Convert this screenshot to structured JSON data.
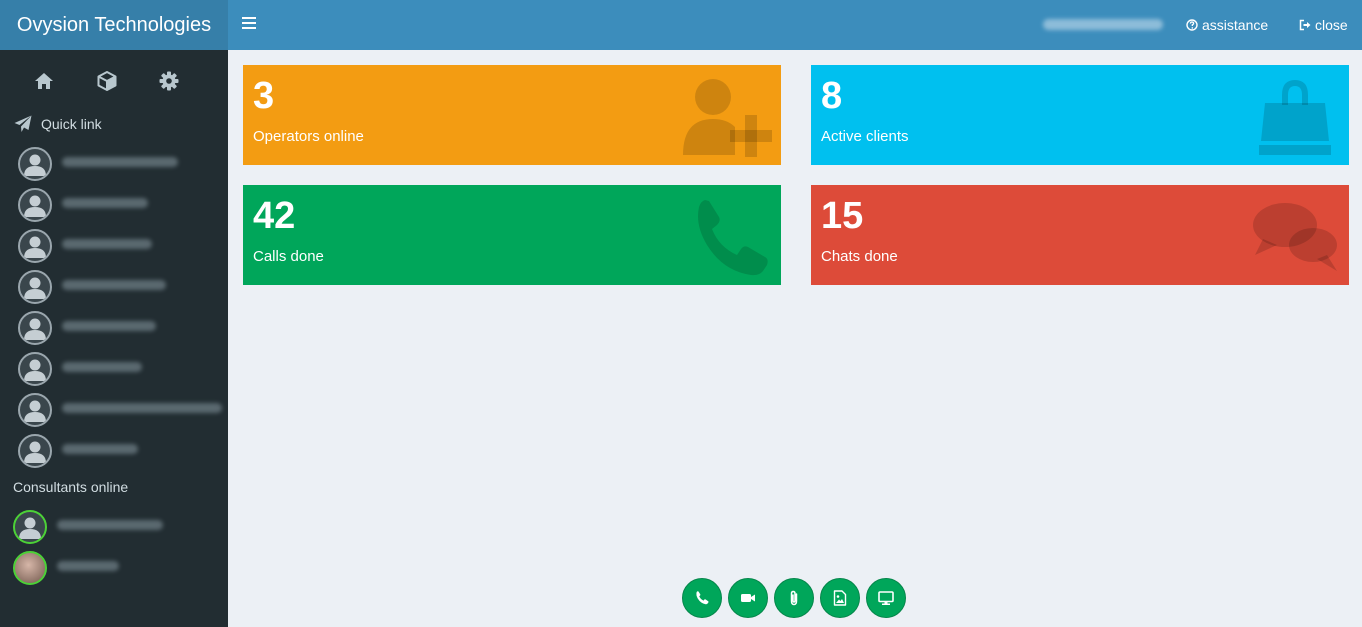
{
  "app": {
    "title": "Ovysion Technologies"
  },
  "topbar": {
    "assistance_label": "assistance",
    "close_label": "close"
  },
  "sidebar": {
    "nav_icons": [
      "home-icon",
      "cube-icon",
      "gear-icon"
    ],
    "quick_link_label": "Quick link",
    "consultants_label": "Consultants online"
  },
  "stats": [
    {
      "value": "3",
      "label": "Operators online",
      "color": "#f39c12",
      "icon": "user-plus-icon"
    },
    {
      "value": "8",
      "label": "Active clients",
      "color": "#00c0ef",
      "icon": "shopping-bag-icon"
    },
    {
      "value": "42",
      "label": "Calls done",
      "color": "#00a65a",
      "icon": "phone-icon"
    },
    {
      "value": "15",
      "label": "Chats done",
      "color": "#dd4b39",
      "icon": "comments-icon"
    }
  ],
  "dock": [
    "phone-call-icon",
    "video-icon",
    "paperclip-icon",
    "image-file-icon",
    "screen-share-icon"
  ],
  "colors": {
    "sidebar": "#222d32",
    "header": "#3c8dbc",
    "logo": "#367fa9",
    "online": "#4cd137",
    "dock": "#00a65a"
  }
}
